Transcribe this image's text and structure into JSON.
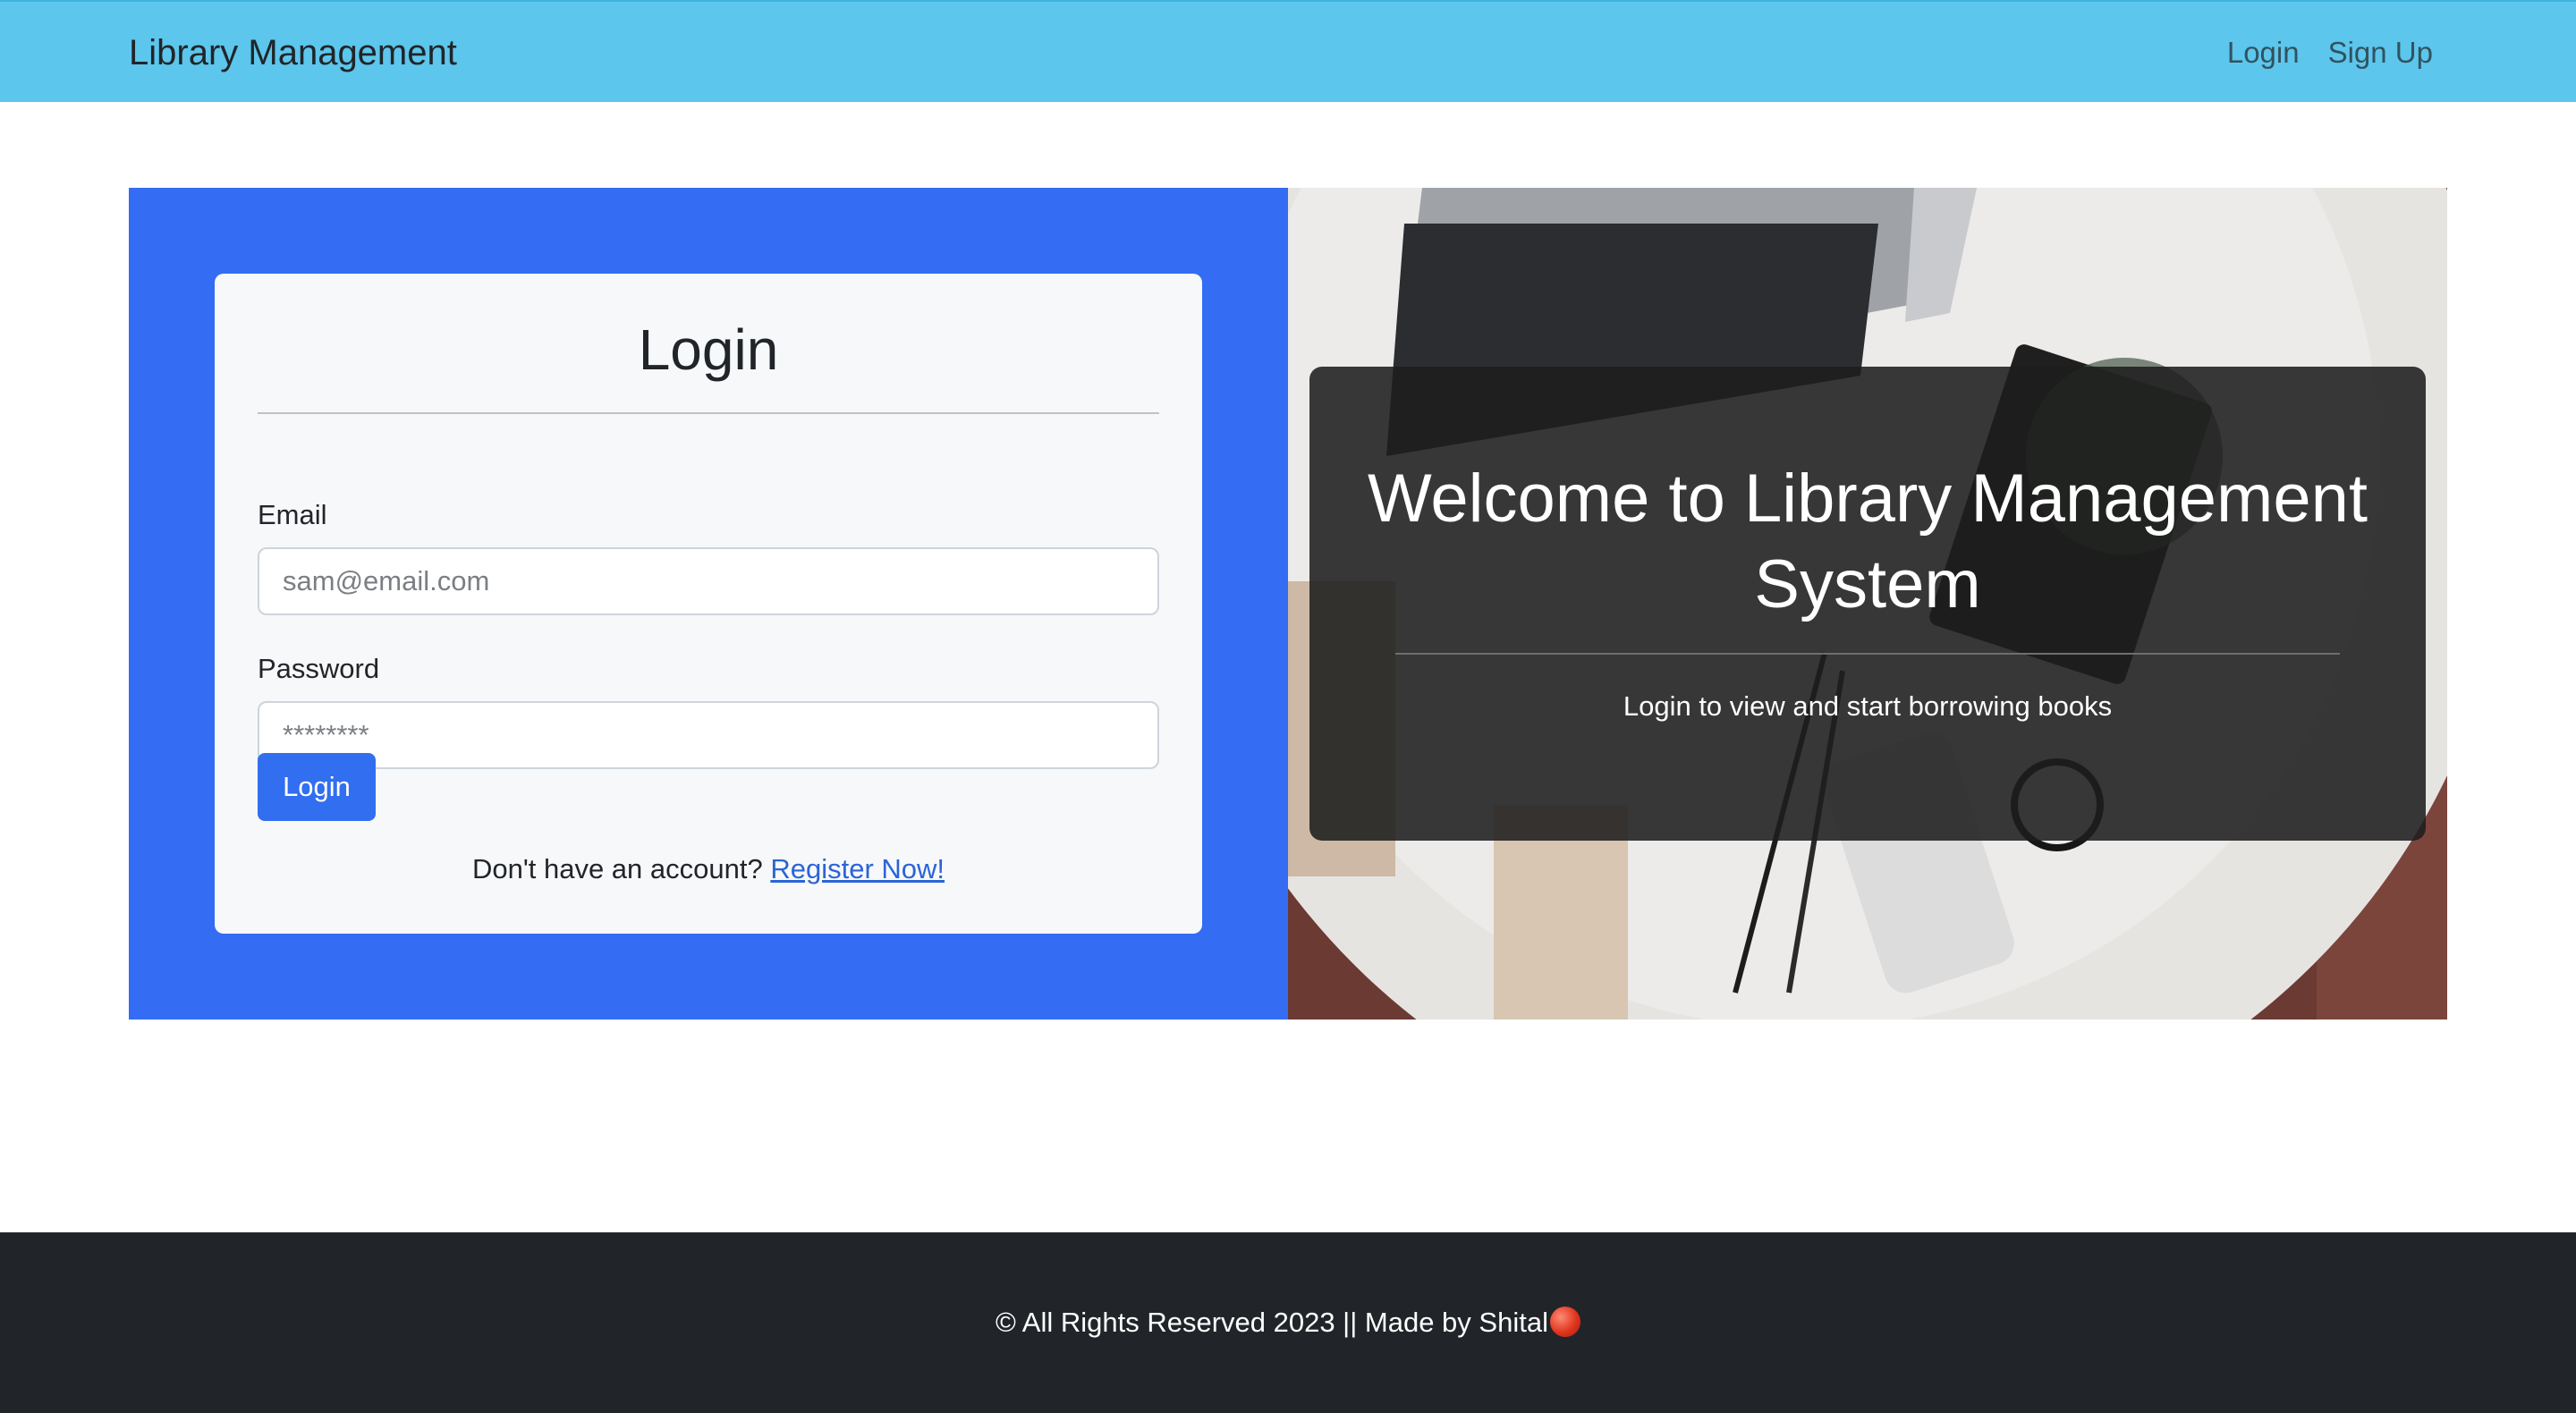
{
  "navbar": {
    "brand": "Library Management",
    "links": [
      "Login",
      "Sign Up"
    ]
  },
  "login_card": {
    "title": "Login",
    "email_label": "Email",
    "email_placeholder": "sam@email.com",
    "email_value": "",
    "password_label": "Password",
    "password_placeholder": "********",
    "password_value": "",
    "submit_label": "Login",
    "register_prompt": "Don't have an account?",
    "register_link": "Register Now!"
  },
  "hero": {
    "welcome": "Welcome to Library Management System",
    "subtitle": "Login to view and start borrowing books",
    "image": "laptop-desk-photo"
  },
  "footer": {
    "text": "© All Rights Reserved 2023 || Made by Shital",
    "emoji_icon": "red-circle-icon"
  },
  "colors": {
    "navbar_bg": "#5cc6ec",
    "hero_panel_bg": "#346cf3",
    "button_bg": "#316ef0",
    "link": "#2a64d8",
    "footer_bg": "#212529"
  }
}
